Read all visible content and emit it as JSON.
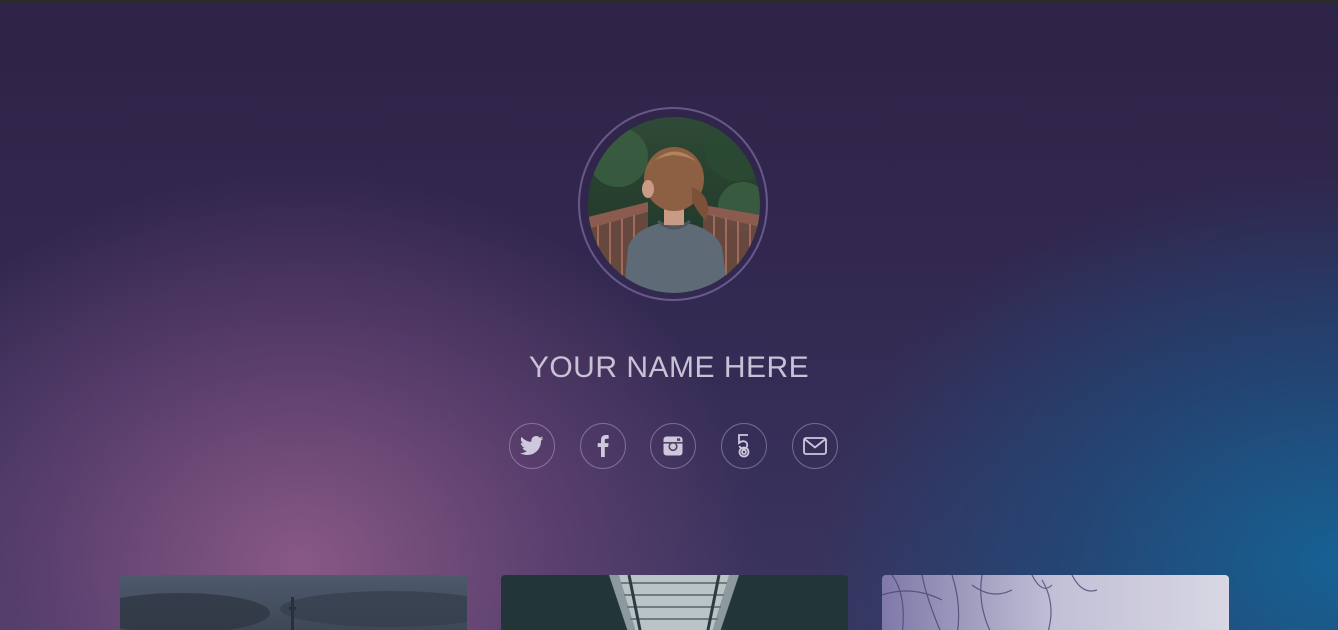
{
  "profile": {
    "name": "YOUR NAME HERE"
  },
  "social_links": [
    {
      "icon": "twitter-icon"
    },
    {
      "icon": "facebook-icon"
    },
    {
      "icon": "instagram-icon"
    },
    {
      "icon": "500px-icon"
    },
    {
      "icon": "mail-icon"
    }
  ],
  "gallery": [
    {
      "subject": "tower-skyline"
    },
    {
      "subject": "bridge-structure"
    },
    {
      "subject": "bare-trees"
    }
  ],
  "colors": {
    "name_text": "#c9c2d6",
    "icon": "#cfc8dd",
    "gradient_pink": "#965f8c",
    "gradient_blue": "#14649a",
    "gradient_base": "#2e2346"
  }
}
